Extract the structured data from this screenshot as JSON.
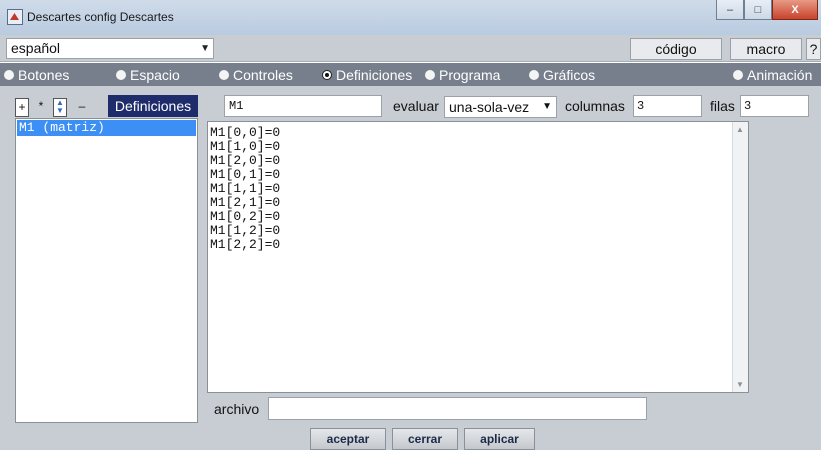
{
  "window": {
    "title": "Descartes config Descartes",
    "controls": {
      "minimize": "–",
      "maximize": "□",
      "close": "X"
    }
  },
  "toolbar": {
    "language": "español",
    "codigo_label": "código",
    "macro_label": "macro",
    "help_label": "?"
  },
  "tabs": [
    {
      "label": "Botones",
      "selected": false
    },
    {
      "label": "Espacio",
      "selected": false
    },
    {
      "label": "Controles",
      "selected": false
    },
    {
      "label": "Definiciones",
      "selected": true
    },
    {
      "label": "Programa",
      "selected": false
    },
    {
      "label": "Gráficos",
      "selected": false
    },
    {
      "label": "Animación",
      "selected": false
    }
  ],
  "sidebar": {
    "tools": {
      "add": "+",
      "star": "*",
      "remove": "–"
    },
    "title": "Definiciones",
    "items": [
      "M1  (matriz)"
    ]
  },
  "definition": {
    "name": "M1",
    "evaluar_label": "evaluar",
    "evaluar_value": "una-sola-vez",
    "columnas_label": "columnas",
    "columnas_value": "3",
    "filas_label": "filas",
    "filas_value": "3",
    "code": "M1[0,0]=0\nM1[1,0]=0\nM1[2,0]=0\nM1[0,1]=0\nM1[1,1]=0\nM1[2,1]=0\nM1[0,2]=0\nM1[1,2]=0\nM1[2,2]=0",
    "archivo_label": "archivo",
    "archivo_value": ""
  },
  "footer": {
    "aceptar": "aceptar",
    "cerrar": "cerrar",
    "aplicar": "aplicar"
  },
  "colors": {
    "tab_bar": "#777e8c",
    "panel_bg": "#c8cdd3",
    "selection": "#3b8ff5",
    "definiciones_label_bg": "#1f2c6b"
  }
}
